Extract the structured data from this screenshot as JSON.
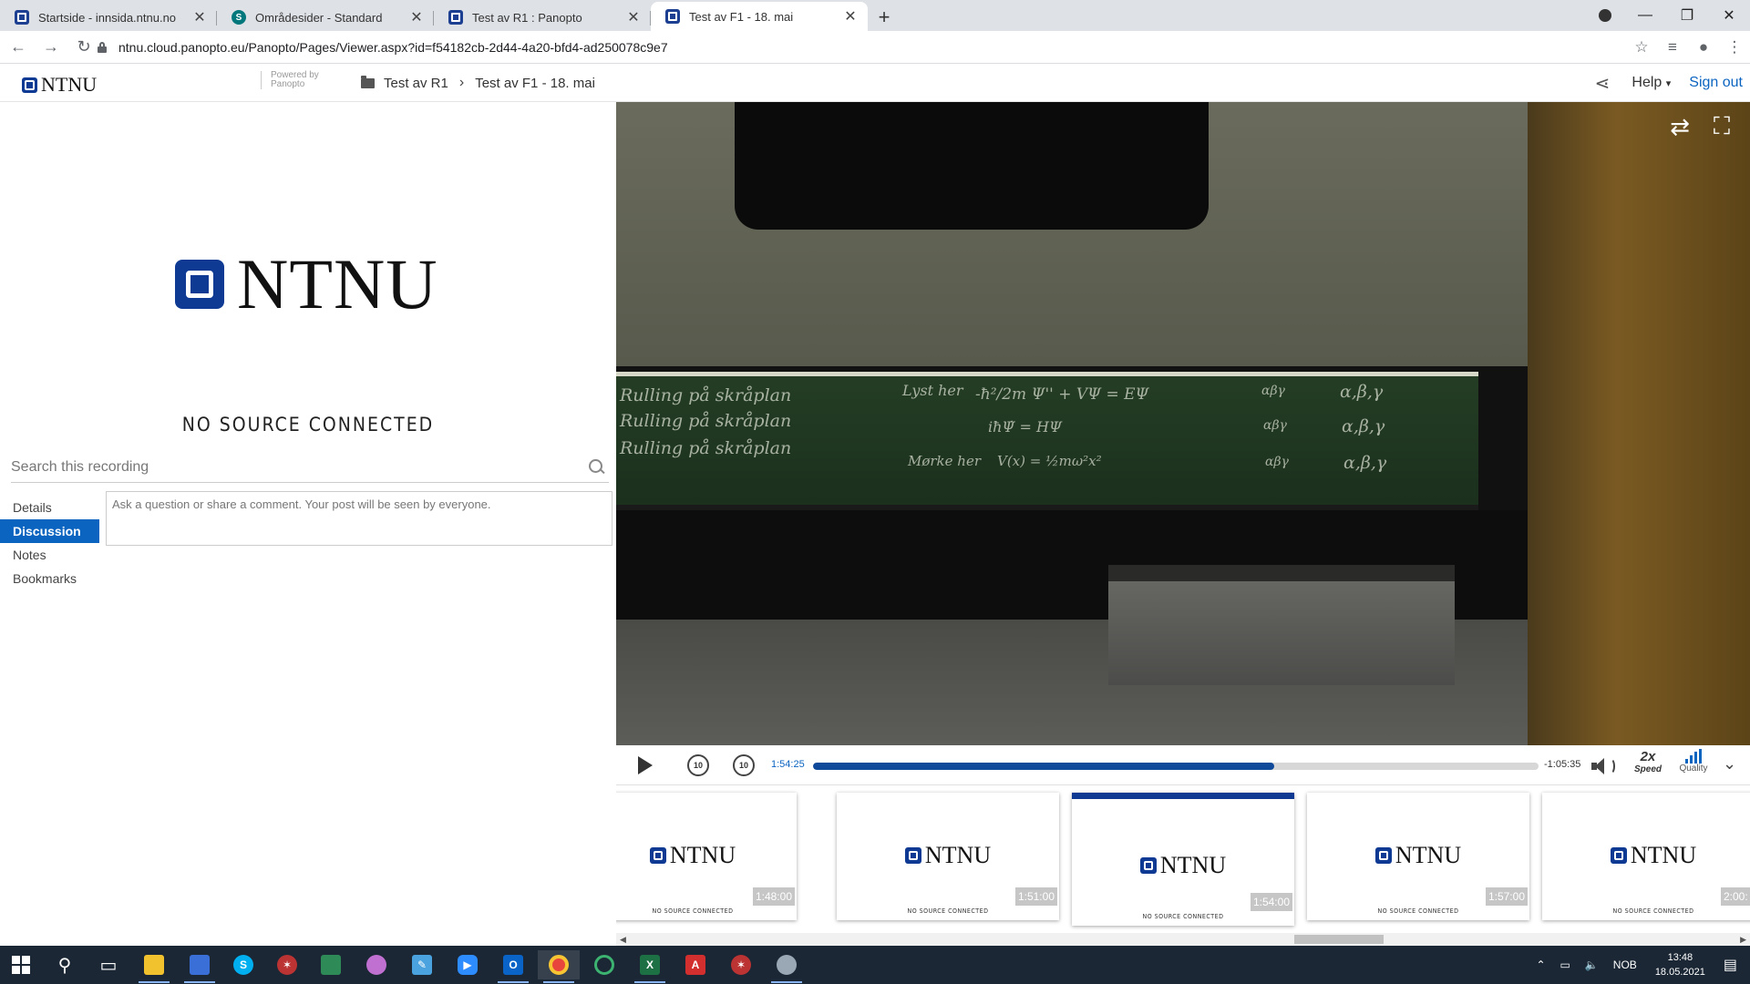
{
  "browser": {
    "tabs": [
      {
        "label": "Startside - innsida.ntnu.no",
        "icon": "ntnu-favicon",
        "active": false
      },
      {
        "label": "Områdesider - Standard",
        "icon": "sharepoint-favicon",
        "active": false
      },
      {
        "label": "Test av R1 : Panopto",
        "icon": "ntnu-favicon",
        "active": false
      },
      {
        "label": "Test av F1 - 18. mai",
        "icon": "ntnu-favicon",
        "active": true
      }
    ],
    "new_tab": "+",
    "close_glyph": "✕",
    "url": "ntnu.cloud.panopto.eu/Panopto/Pages/Viewer.aspx?id=f54182cb-2d44-4a20-bfd4-ad250078c9e7"
  },
  "header": {
    "logo_text": "NTNU",
    "powered_by": "Powered by",
    "powered_brand": "Panopto",
    "breadcrumb": [
      "Test av R1",
      "Test av F1 - 18. mai"
    ],
    "help_label": "Help",
    "signout_label": "Sign out"
  },
  "left_panel": {
    "logo_text": "NTNU",
    "no_source": "NO SOURCE CONNECTED",
    "search_placeholder": "Search this recording",
    "tabs": [
      {
        "label": "Details",
        "active": false
      },
      {
        "label": "Discussion",
        "active": true
      },
      {
        "label": "Notes",
        "active": false
      },
      {
        "label": "Bookmarks",
        "active": false
      }
    ],
    "comment_placeholder": "Ask a question or share a comment. Your post will be seen by everyone."
  },
  "player": {
    "skip_back": "10",
    "skip_forward": "10",
    "elapsed": "1:54:25",
    "remaining": "-1:05:35",
    "progress_fraction": 0.636,
    "speed_value": "2x",
    "speed_label": "Speed",
    "quality_label": "Quality",
    "video_board_text": [
      "Rulling på skråplan",
      "Rulling på skråplan",
      "Rulling på skråplan",
      "Lyst her",
      "Mørke her",
      "-ħ²/2m Ψ'' + VΨ = EΨ",
      "iħΨ̇ = HΨ",
      "V(x) = ½mω²x²",
      "α,β,γ",
      "α,β,γ",
      "α,β,γ",
      "αβγ",
      "αβγ",
      "αβγ"
    ]
  },
  "thumbnails": [
    {
      "logo": "NTNU",
      "caption": "NO SOURCE CONNECTED",
      "time": "1:48:00",
      "active": false
    },
    {
      "logo": "NTNU",
      "caption": "NO SOURCE CONNECTED",
      "time": "1:51:00",
      "active": false
    },
    {
      "logo": "NTNU",
      "caption": "NO SOURCE CONNECTED",
      "time": "1:54:00",
      "active": true
    },
    {
      "logo": "NTNU",
      "caption": "NO SOURCE CONNECTED",
      "time": "1:57:00",
      "active": false
    },
    {
      "logo": "NTNU",
      "caption": "NO SOURCE CONNECTED",
      "time": "2:00:",
      "active": false
    }
  ],
  "taskbar": {
    "language": "NOB",
    "time": "13:48",
    "date": "18.05.2021"
  },
  "colors": {
    "ntnu_blue": "#0f3a93",
    "accent_blue": "#0b64c0",
    "taskbar": "#1b2735"
  }
}
